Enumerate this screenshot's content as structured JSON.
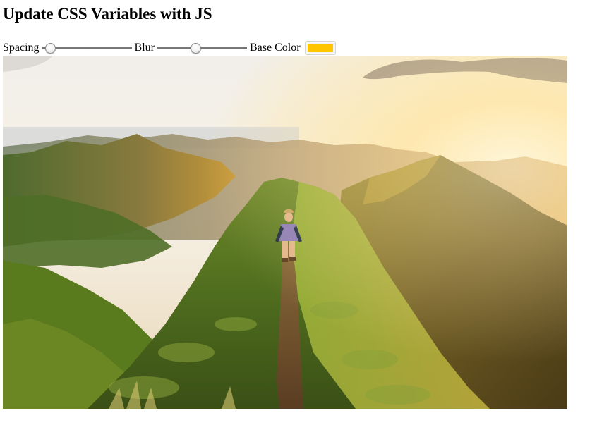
{
  "page": {
    "title": "Update CSS Variables with JS"
  },
  "controls": {
    "spacing": {
      "label": "Spacing",
      "value": 0.05
    },
    "blur": {
      "label": "Blur",
      "value": 0.42
    },
    "base_color": {
      "label": "Base Color",
      "value": "#FFC600"
    }
  },
  "image": {
    "subject": "hiker-on-mountain-ridge-at-sunset"
  }
}
